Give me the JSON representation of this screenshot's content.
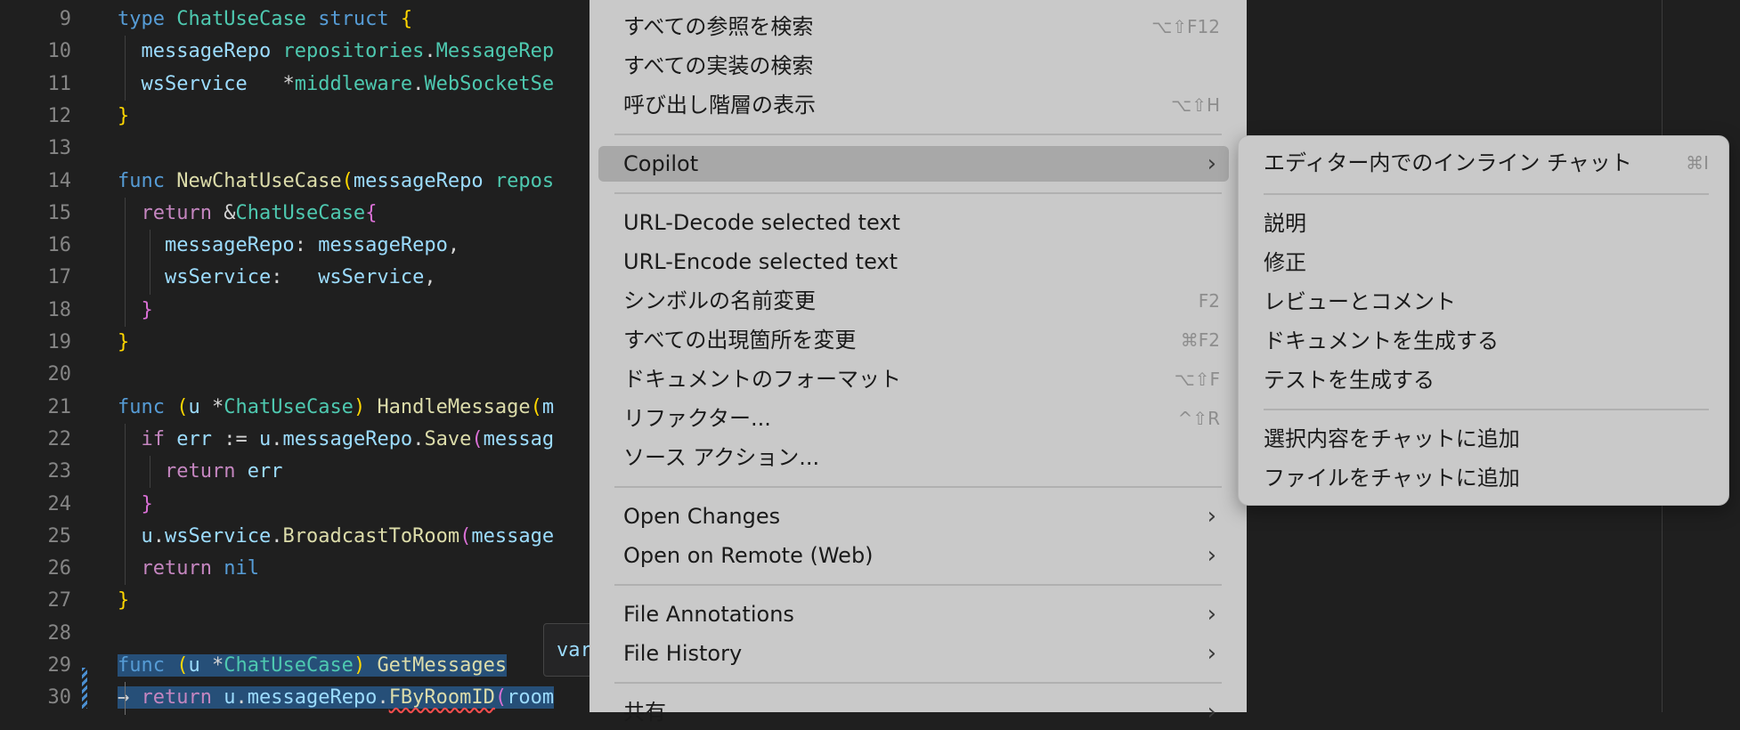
{
  "editor": {
    "lines": [
      {
        "n": "9",
        "tokens": [
          [
            "kw",
            "type"
          ],
          [
            "op",
            " "
          ],
          [
            "ty",
            "ChatUseCase"
          ],
          [
            "op",
            " "
          ],
          [
            "kw",
            "struct"
          ],
          [
            "op",
            " "
          ],
          [
            "br1",
            "{"
          ]
        ]
      },
      {
        "n": "10",
        "tokens": [
          [
            "op",
            "  "
          ],
          [
            "va",
            "messageRepo"
          ],
          [
            "op",
            " "
          ],
          [
            "ty",
            "repositories"
          ],
          [
            "op",
            "."
          ],
          [
            "ty",
            "MessageRep"
          ]
        ]
      },
      {
        "n": "11",
        "tokens": [
          [
            "op",
            "  "
          ],
          [
            "va",
            "wsService"
          ],
          [
            "op",
            "   *"
          ],
          [
            "ty",
            "middleware"
          ],
          [
            "op",
            "."
          ],
          [
            "ty",
            "WebSocketSe"
          ]
        ]
      },
      {
        "n": "12",
        "tokens": [
          [
            "br1",
            "}"
          ]
        ]
      },
      {
        "n": "13",
        "tokens": []
      },
      {
        "n": "14",
        "tokens": [
          [
            "kw",
            "func"
          ],
          [
            "op",
            " "
          ],
          [
            "fn",
            "NewChatUseCase"
          ],
          [
            "br1",
            "("
          ],
          [
            "va",
            "messageRepo"
          ],
          [
            "op",
            " "
          ],
          [
            "ty",
            "repos"
          ]
        ]
      },
      {
        "n": "15",
        "tokens": [
          [
            "op",
            "  "
          ],
          [
            "kwc",
            "return"
          ],
          [
            "op",
            " &"
          ],
          [
            "ty",
            "ChatUseCase"
          ],
          [
            "br2",
            "{"
          ]
        ]
      },
      {
        "n": "16",
        "tokens": [
          [
            "op",
            "    "
          ],
          [
            "va",
            "messageRepo"
          ],
          [
            "op",
            ": "
          ],
          [
            "va",
            "messageRepo"
          ],
          [
            "op",
            ","
          ]
        ]
      },
      {
        "n": "17",
        "tokens": [
          [
            "op",
            "    "
          ],
          [
            "va",
            "wsService"
          ],
          [
            "op",
            ":   "
          ],
          [
            "va",
            "wsService"
          ],
          [
            "op",
            ","
          ]
        ]
      },
      {
        "n": "18",
        "tokens": [
          [
            "op",
            "  "
          ],
          [
            "br2",
            "}"
          ]
        ]
      },
      {
        "n": "19",
        "tokens": [
          [
            "br1",
            "}"
          ]
        ]
      },
      {
        "n": "20",
        "tokens": []
      },
      {
        "n": "21",
        "tokens": [
          [
            "kw",
            "func"
          ],
          [
            "op",
            " "
          ],
          [
            "br1",
            "("
          ],
          [
            "va",
            "u"
          ],
          [
            "op",
            " *"
          ],
          [
            "ty",
            "ChatUseCase"
          ],
          [
            "br1",
            ")"
          ],
          [
            "op",
            " "
          ],
          [
            "fn",
            "HandleMessage"
          ],
          [
            "br1",
            "("
          ],
          [
            "va",
            "m"
          ]
        ]
      },
      {
        "n": "22",
        "tokens": [
          [
            "op",
            "  "
          ],
          [
            "kwc",
            "if"
          ],
          [
            "op",
            " "
          ],
          [
            "va",
            "err"
          ],
          [
            "op",
            " := "
          ],
          [
            "va",
            "u"
          ],
          [
            "op",
            "."
          ],
          [
            "va",
            "messageRepo"
          ],
          [
            "op",
            "."
          ],
          [
            "fn",
            "Save"
          ],
          [
            "br2",
            "("
          ],
          [
            "va",
            "messag"
          ]
        ]
      },
      {
        "n": "23",
        "tokens": [
          [
            "op",
            "    "
          ],
          [
            "kwc",
            "return"
          ],
          [
            "op",
            " "
          ],
          [
            "va",
            "err"
          ]
        ]
      },
      {
        "n": "24",
        "tokens": [
          [
            "op",
            "  "
          ],
          [
            "br2",
            "}"
          ]
        ]
      },
      {
        "n": "25",
        "tokens": [
          [
            "op",
            "  "
          ],
          [
            "va",
            "u"
          ],
          [
            "op",
            "."
          ],
          [
            "va",
            "wsService"
          ],
          [
            "op",
            "."
          ],
          [
            "fn",
            "BroadcastToRoom"
          ],
          [
            "br2",
            "("
          ],
          [
            "va",
            "message"
          ]
        ]
      },
      {
        "n": "26",
        "tokens": [
          [
            "op",
            "  "
          ],
          [
            "kwc",
            "return"
          ],
          [
            "op",
            " "
          ],
          [
            "kw",
            "nil"
          ]
        ]
      },
      {
        "n": "27",
        "tokens": [
          [
            "br1",
            "}"
          ]
        ]
      },
      {
        "n": "28",
        "tokens": []
      },
      {
        "n": "29",
        "hl": true,
        "tokens": [
          [
            "kw",
            "func"
          ],
          [
            "op",
            " "
          ],
          [
            "br1",
            "("
          ],
          [
            "va",
            "u"
          ],
          [
            "op",
            " *"
          ],
          [
            "ty",
            "ChatUseCase"
          ],
          [
            "br1",
            ")"
          ],
          [
            "op",
            " "
          ],
          [
            "fn",
            "GetMessages"
          ]
        ]
      },
      {
        "n": "30",
        "hl": true,
        "tokens": [
          [
            "op",
            "→ "
          ],
          [
            "kwc",
            "return"
          ],
          [
            "op",
            " "
          ],
          [
            "va",
            "u"
          ],
          [
            "op",
            "."
          ],
          [
            "va",
            "messageRepo"
          ],
          [
            "op",
            "."
          ],
          [
            "fn",
            "FByRoomID",
            "err"
          ],
          [
            "br2",
            "("
          ],
          [
            "va",
            "room"
          ]
        ]
      }
    ],
    "hover_text": "var"
  },
  "context_menu": {
    "items": [
      {
        "label": "すべての参照を検索",
        "shortcut": "⌥⇧F12"
      },
      {
        "label": "すべての実装の検索",
        "shortcut": ""
      },
      {
        "label": "呼び出し階層の表示",
        "shortcut": "⌥⇧H"
      },
      {
        "sep": true
      },
      {
        "label": "Copilot",
        "submenu": true,
        "active": true
      },
      {
        "sep": true
      },
      {
        "label": "URL-Decode selected text",
        "shortcut": ""
      },
      {
        "label": "URL-Encode selected text",
        "shortcut": ""
      },
      {
        "label": "シンボルの名前変更",
        "shortcut": "F2"
      },
      {
        "label": "すべての出現箇所を変更",
        "shortcut": "⌘F2"
      },
      {
        "label": "ドキュメントのフォーマット",
        "shortcut": "⌥⇧F"
      },
      {
        "label": "リファクター...",
        "shortcut": "^⇧R"
      },
      {
        "label": "ソース アクション...",
        "shortcut": ""
      },
      {
        "sep": true
      },
      {
        "label": "Open Changes",
        "submenu": true
      },
      {
        "label": "Open on Remote (Web)",
        "submenu": true
      },
      {
        "sep": true
      },
      {
        "label": "File Annotations",
        "submenu": true
      },
      {
        "label": "File History",
        "submenu": true
      },
      {
        "sep": true
      },
      {
        "label": "共有",
        "submenu": true
      }
    ]
  },
  "copilot_submenu": {
    "items": [
      {
        "label": "エディター内でのインライン チャット",
        "shortcut": "⌘I"
      },
      {
        "sep": true
      },
      {
        "label": "説明"
      },
      {
        "label": "修正"
      },
      {
        "label": "レビューとコメント"
      },
      {
        "label": "ドキュメントを生成する"
      },
      {
        "label": "テストを生成する"
      },
      {
        "sep": true
      },
      {
        "label": "選択内容をチャットに追加"
      },
      {
        "label": "ファイルをチャットに追加"
      }
    ]
  },
  "icons": {
    "submenu_chevron": "chevron-right-icon"
  },
  "colors": {
    "editor_bg": "#1f1f1f",
    "menu_bg": "#c9c9c9",
    "selection": "#264f78"
  }
}
